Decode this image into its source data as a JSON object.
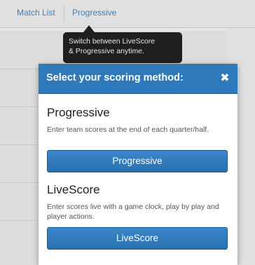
{
  "nav": {
    "tabs": [
      "Match List",
      "Progressive"
    ]
  },
  "tooltip": {
    "text_line1": "Switch between LiveScore",
    "text_line2": "& Progressive anytime."
  },
  "modal": {
    "title": "Select your scoring method:",
    "close_icon": "close-icon",
    "options": [
      {
        "title": "Progressive",
        "description": "Enter team scores at the end of each quarter/half.",
        "button_label": "Progressive"
      },
      {
        "title": "LiveScore",
        "description": "Enter scores live with a game clock, play by play and player actions.",
        "button_label": "LiveScore"
      }
    ]
  },
  "colors": {
    "accent": "#2f79bb",
    "tooltip_bg": "#1f1f1f",
    "nav_text": "#4f86b8"
  }
}
